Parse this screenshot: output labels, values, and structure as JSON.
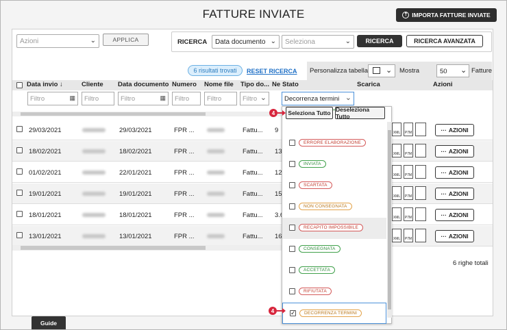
{
  "header": {
    "title": "FATTURE INVIATE",
    "import_button": "IMPORTA FATTURE INVIATE"
  },
  "toolbar": {
    "actions_placeholder": "Azioni",
    "apply_label": "APPLICA",
    "search_label": "RICERCA",
    "search_field_value": "Data documento",
    "search_value_placeholder": "Seleziona",
    "search_button": "RICERCA",
    "advanced_search_button": "RICERCA AVANZATA"
  },
  "results": {
    "count_label": "6 risultati trovati",
    "reset_label": "RESET RICERCA"
  },
  "table_options": {
    "customize_label": "Personalizza tabella",
    "show_label": "Mostra",
    "page_size": "50",
    "suffix_label": "Fatture"
  },
  "columns": [
    "Data invio",
    "Cliente",
    "Data documento",
    "Numero",
    "Nome file",
    "Tipo do...",
    "Ne",
    "Stato",
    "Scarica",
    "Azioni"
  ],
  "sort_icon": "arrow-down",
  "filter_placeholder": "Filtro",
  "stato_filter_value": "Decorrenza termini",
  "rows": [
    {
      "data_invio": "29/03/2021",
      "data_documento": "29/03/2021",
      "numero": "FPR ...",
      "tipo": "Fattu...",
      "ne": "9"
    },
    {
      "data_invio": "18/02/2021",
      "data_documento": "18/02/2021",
      "numero": "FPR ...",
      "tipo": "Fattu...",
      "ne": "13"
    },
    {
      "data_invio": "01/02/2021",
      "data_documento": "22/01/2021",
      "numero": "FPR ...",
      "tipo": "Fattu...",
      "ne": "12"
    },
    {
      "data_invio": "19/01/2021",
      "data_documento": "19/01/2021",
      "numero": "FPR ...",
      "tipo": "Fattu...",
      "ne": "15"
    },
    {
      "data_invio": "18/01/2021",
      "data_documento": "18/01/2021",
      "numero": "FPR ...",
      "tipo": "Fattu...",
      "ne": "3.6"
    },
    {
      "data_invio": "13/01/2021",
      "data_documento": "13/01/2021",
      "numero": "FPR ...",
      "tipo": "Fattu...",
      "ne": "16"
    }
  ],
  "download_labels": {
    "xml": "XML",
    "p7m": "P7M"
  },
  "row_action_label": "AZIONI",
  "total_rows": "6 righe totali",
  "dropdown": {
    "select_all": "Seleziona Tutto",
    "deselect_all": "Deseleziona Tutto",
    "options": [
      {
        "label": "ERRORE ELABORAZIONE",
        "color": "red",
        "checked": false
      },
      {
        "label": "INVIATA",
        "color": "green",
        "checked": false
      },
      {
        "label": "SCARTATA",
        "color": "red",
        "checked": false
      },
      {
        "label": "NON CONSEGNATA",
        "color": "orange",
        "checked": false
      },
      {
        "label": "RECAPITO IMPOSSIBILE",
        "color": "red",
        "checked": false
      },
      {
        "label": "CONSEGNATA",
        "color": "green",
        "checked": false
      },
      {
        "label": "ACCETTATA",
        "color": "green",
        "checked": false
      },
      {
        "label": "RIFIUTATA",
        "color": "red",
        "checked": false
      },
      {
        "label": "DECORRENZA TERMINI",
        "color": "orange",
        "checked": true
      }
    ]
  },
  "markers": [
    "4",
    "4"
  ],
  "footer": {
    "guide_tab": "Guide"
  },
  "colors": {
    "accent_dark": "#333333",
    "link_blue": "#1d6fc6",
    "marker_red": "#d7263d"
  }
}
